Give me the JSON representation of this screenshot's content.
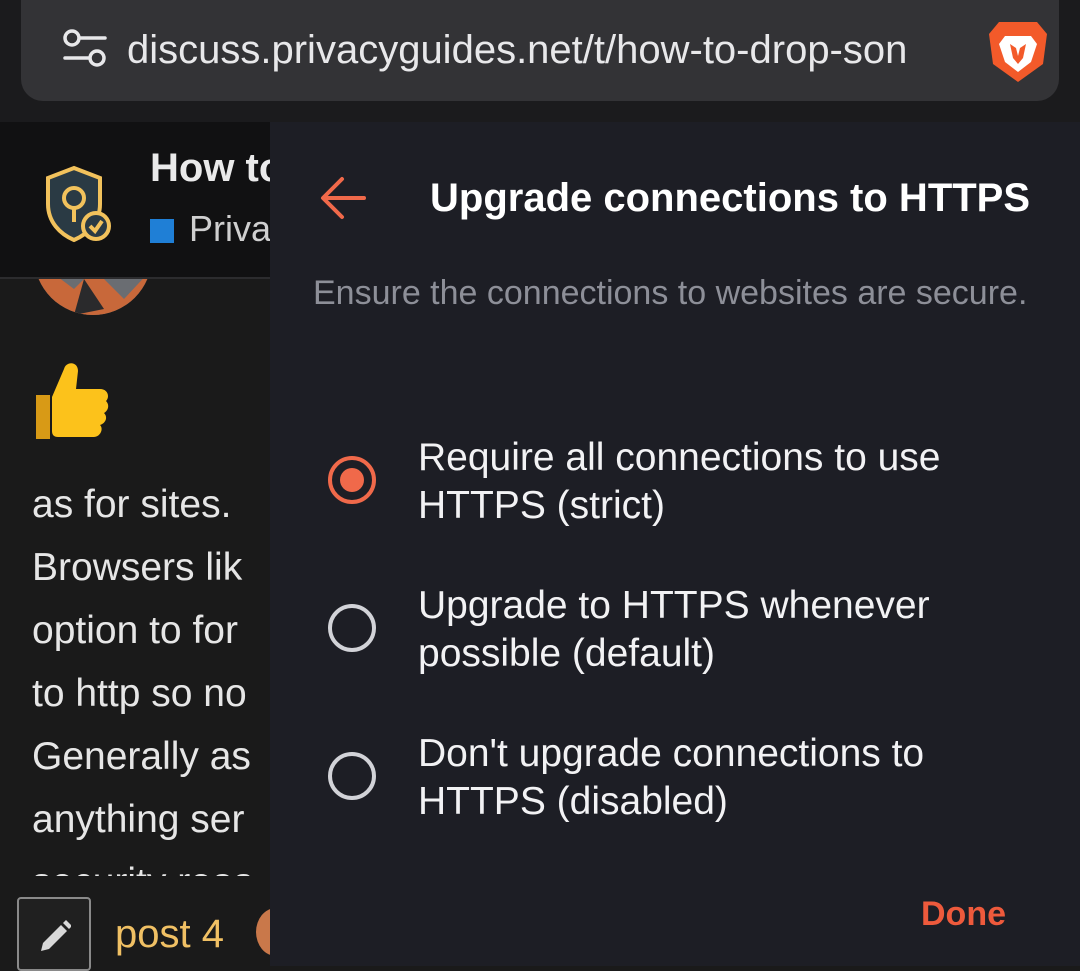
{
  "browser": {
    "url": "discuss.privacyguides.net/t/how-to-drop-son",
    "icons": {
      "site_settings": "tune-icon",
      "brave": "brave-lion-icon"
    }
  },
  "site": {
    "topic_title": "How to",
    "category": "Priva",
    "category_color": "#1f7fd6",
    "post_lines": [
      "as for sites.",
      "Browsers lik",
      "option to for",
      "to http so no",
      "Generally as",
      "anything ser",
      "security reas"
    ],
    "emoji": "thumbs-up-icon",
    "post_count": "post 4"
  },
  "panel": {
    "title": "Upgrade connections to HTTPS",
    "description": "Ensure the connections to websites are secure.",
    "accent": "#f0694a",
    "options": [
      {
        "label": "Require all connections to use HTTPS (strict)",
        "selected": true
      },
      {
        "label": "Upgrade to HTTPS whenever possible (default)",
        "selected": false
      },
      {
        "label": "Don't upgrade connections to HTTPS (disabled)",
        "selected": false
      }
    ],
    "done_label": "Done"
  }
}
